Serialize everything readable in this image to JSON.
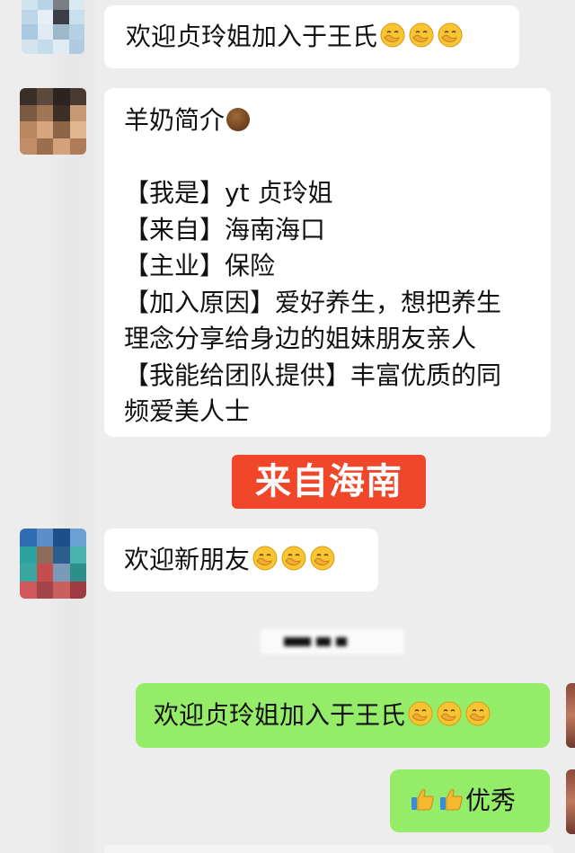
{
  "messages": {
    "welcome_1": "欢迎贞玲姐加入于王氏",
    "intro_lines": [
      "羊奶简介",
      "",
      "【我是】yt 贞玲姐",
      "【来自】海南海口",
      "【主业】保险",
      "【加入原因】爱好养生，想把养生",
      "理念分享给身边的姐妹朋友亲人",
      "【我能给团队提供】丰富优质的同",
      "频爱美人士"
    ],
    "welcome_2": "欢迎新朋友",
    "welcome_out": "欢迎贞玲姐加入于王氏",
    "excellent_out": "优秀"
  },
  "banner": {
    "text": "来自海南",
    "color": "#f0472a"
  },
  "colors": {
    "background": "#ededed",
    "incoming": "#ffffff",
    "outgoing": "#95ec69"
  },
  "icons": {
    "hush_face": "face-with-hand-over-mouth-icon",
    "thumbs_up": "thumbs-up-icon",
    "brown_circle": "brown-circle-icon"
  }
}
